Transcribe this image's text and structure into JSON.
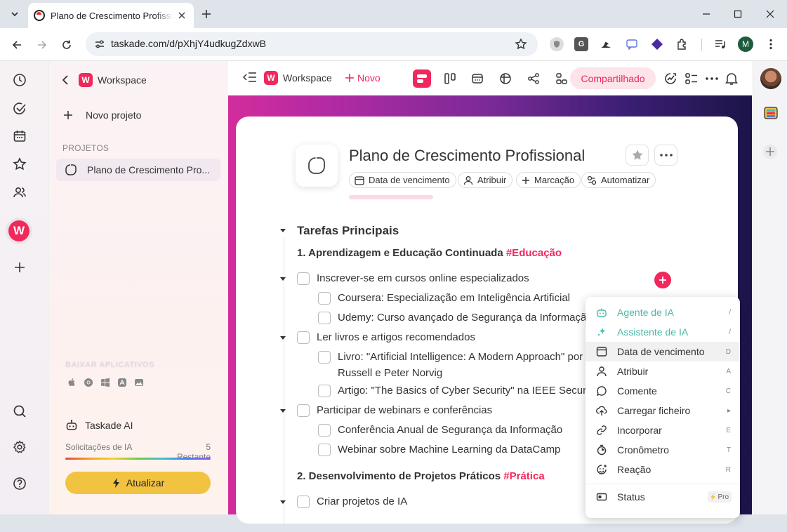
{
  "browser": {
    "tab_title": "Plano de Crescimento Profissional",
    "url": "taskade.com/d/pXhjY4udkugZdxwB",
    "profile_initial": "M",
    "extension_g_label": "G"
  },
  "sidebar": {
    "workspace_name": "Workspace",
    "workspace_logo": "W",
    "new_project": "Novo projeto",
    "projects_header": "PROJETOS",
    "project_item": "Plano de Crescimento Pro...",
    "download_apps": "BAIXAR APLICATIVOS",
    "ai_title": "Taskade AI",
    "ai_requests_label": "Solicitações de IA",
    "ai_remaining": "5 Restante",
    "upgrade_label": "Atualizar"
  },
  "rail": {
    "workspace_logo": "W"
  },
  "header": {
    "workspace_name": "Workspace",
    "workspace_logo": "W",
    "new_label": "Novo",
    "share_label": "Compartilhado"
  },
  "project": {
    "title": "Plano de Crescimento Profissional",
    "chips": {
      "due_date": "Data de vencimento",
      "assign": "Atribuir",
      "tag": "Marcação",
      "automate": "Automatizar"
    }
  },
  "outline": {
    "main": "Tarefas Principais",
    "section1": {
      "label": "1. Aprendizagem e Educação Continuada",
      "tag": "#Educação"
    },
    "task1": "Inscrever-se em cursos online especializados",
    "task1a": "Coursera: Especialização em Inteligência Artificial",
    "task1b": "Udemy: Curso avançado de Segurança da Informação",
    "task2": "Ler livros e artigos recomendados",
    "task2a_line1": "Livro: \"Artificial Intelligence: A Modern Approach\" por Stuart",
    "task2a_line2": "Russell e Peter Norvig",
    "task2b": "Artigo: \"The Basics of Cyber Security\" na IEEE Security",
    "task3": "Participar de webinars e conferências",
    "task3a": "Conferência Anual de Segurança da Informação",
    "task3b": "Webinar sobre Machine Learning da DataCamp",
    "section2": {
      "label": "2. Desenvolvimento de Projetos Práticos",
      "tag": "#Prática"
    },
    "task4": "Criar projetos de IA"
  },
  "menu": {
    "items": [
      {
        "label": "Agente de IA",
        "shortcut": "/"
      },
      {
        "label": "Assistente de IA",
        "shortcut": "/"
      },
      {
        "label": "Data de vencimento",
        "shortcut": "D"
      },
      {
        "label": "Atribuir",
        "shortcut": "A"
      },
      {
        "label": "Comente",
        "shortcut": "C"
      },
      {
        "label": "Carregar ficheiro",
        "shortcut": "▸"
      },
      {
        "label": "Incorporar",
        "shortcut": "E"
      },
      {
        "label": "Cronômetro",
        "shortcut": "T"
      },
      {
        "label": "Reação",
        "shortcut": "R"
      }
    ],
    "status": {
      "label": "Status",
      "badge": "Pro"
    }
  },
  "colors": {
    "brand": "#f0285c",
    "ai_teal": "#4bb8a8",
    "upgrade": "#f2c340"
  }
}
